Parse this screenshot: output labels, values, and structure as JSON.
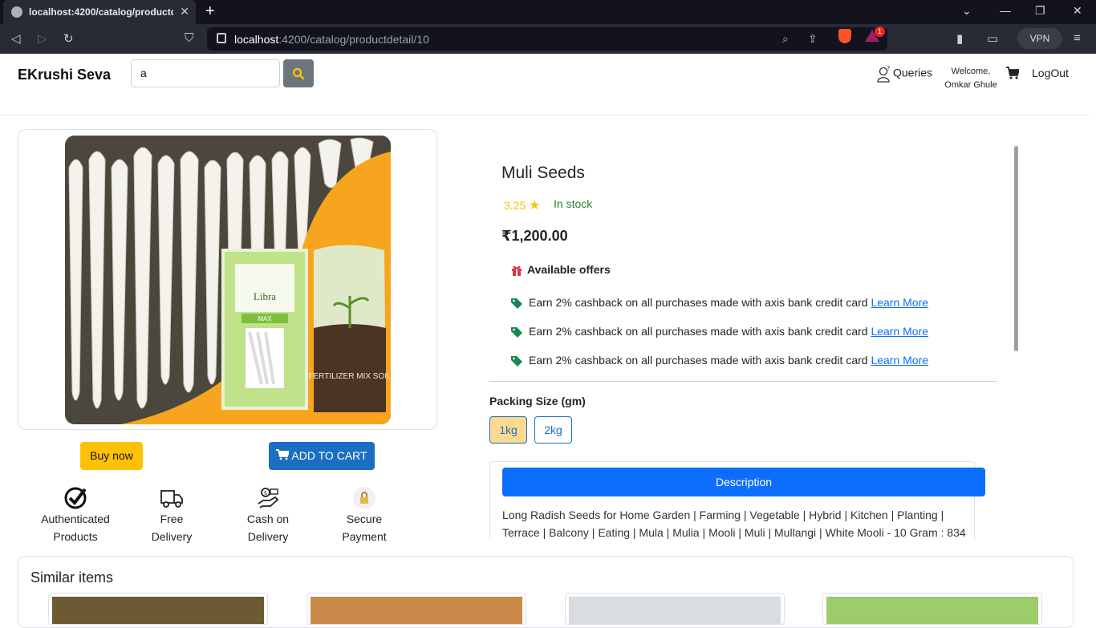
{
  "browser": {
    "tab_title": "localhost:4200/catalog/productd",
    "url_host": "localhost",
    "url_path": ":4200/catalog/productdetail/10",
    "vpn_label": "VPN",
    "badge_count": "1"
  },
  "header": {
    "brand": "EKrushi Seva",
    "search_value": "a",
    "queries_label": "Queries",
    "welcome_line1": "Welcome,",
    "welcome_line2": "Omkar Ghule",
    "logout_label": "LogOut"
  },
  "actions": {
    "buy_now": "Buy now",
    "add_to_cart": "ADD TO CART"
  },
  "features": [
    {
      "line1": "Authenticated",
      "line2": "Products",
      "icon": "check-badge-icon"
    },
    {
      "line1": "Free",
      "line2": "Delivery",
      "icon": "truck-icon"
    },
    {
      "line1": "Cash on",
      "line2": "Delivery",
      "icon": "cash-hand-icon"
    },
    {
      "line1": "Secure",
      "line2": "Payment",
      "icon": "lock-icon"
    }
  ],
  "product": {
    "name": "Muli Seeds",
    "rating": "3.25",
    "stock": "In stock",
    "price": "₹1,200.00",
    "offers_heading": "Available offers",
    "offers": [
      {
        "text": "Earn 2% cashback on all purchases made with axis bank credit card",
        "link": "Learn More"
      },
      {
        "text": "Earn 2% cashback on all purchases made with axis bank credit card",
        "link": "Learn More"
      },
      {
        "text": "Earn 2% cashback on all purchases made with axis bank credit card",
        "link": "Learn More"
      }
    ],
    "packing_heading": "Packing Size (gm)",
    "sizes": [
      "1kg",
      "2kg"
    ],
    "selected_size": "1kg",
    "description_label": "Description",
    "description_text": "Long Radish Seeds for Home Garden | Farming | Vegetable | Hybrid | Kitchen | Planting | Terrace | Balcony | Eating | Mula | Mulia | Mooli | Muli | Mullangi | White Mooli - 10 Gram : 834"
  },
  "image_text": {
    "pack_brand": "Libra",
    "pack_variety": "MAX",
    "bag_title": "FERTILIZER MIX SOIL"
  },
  "similar": {
    "heading": "Similar items"
  },
  "colors": {
    "accent_blue": "#1b6ec2",
    "primary_blue": "#0d6efd",
    "warning_yellow": "#ffc107",
    "stock_green": "#2e7d32",
    "offer_tag_green": "#198754",
    "gift_red": "#dc3545"
  }
}
